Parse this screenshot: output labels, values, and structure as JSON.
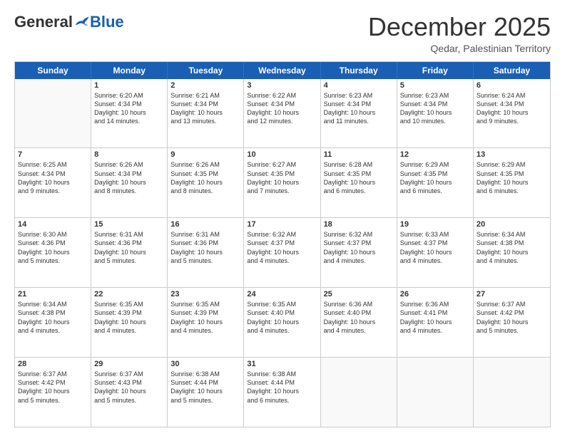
{
  "logo": {
    "general": "General",
    "blue": "Blue"
  },
  "title": "December 2025",
  "location": "Qedar, Palestinian Territory",
  "days_of_week": [
    "Sunday",
    "Monday",
    "Tuesday",
    "Wednesday",
    "Thursday",
    "Friday",
    "Saturday"
  ],
  "weeks": [
    [
      {
        "day": "",
        "info": ""
      },
      {
        "day": "1",
        "info": "Sunrise: 6:20 AM\nSunset: 4:34 PM\nDaylight: 10 hours\nand 14 minutes."
      },
      {
        "day": "2",
        "info": "Sunrise: 6:21 AM\nSunset: 4:34 PM\nDaylight: 10 hours\nand 13 minutes."
      },
      {
        "day": "3",
        "info": "Sunrise: 6:22 AM\nSunset: 4:34 PM\nDaylight: 10 hours\nand 12 minutes."
      },
      {
        "day": "4",
        "info": "Sunrise: 6:23 AM\nSunset: 4:34 PM\nDaylight: 10 hours\nand 11 minutes."
      },
      {
        "day": "5",
        "info": "Sunrise: 6:23 AM\nSunset: 4:34 PM\nDaylight: 10 hours\nand 10 minutes."
      },
      {
        "day": "6",
        "info": "Sunrise: 6:24 AM\nSunset: 4:34 PM\nDaylight: 10 hours\nand 9 minutes."
      }
    ],
    [
      {
        "day": "7",
        "info": "Sunrise: 6:25 AM\nSunset: 4:34 PM\nDaylight: 10 hours\nand 9 minutes."
      },
      {
        "day": "8",
        "info": "Sunrise: 6:26 AM\nSunset: 4:34 PM\nDaylight: 10 hours\nand 8 minutes."
      },
      {
        "day": "9",
        "info": "Sunrise: 6:26 AM\nSunset: 4:35 PM\nDaylight: 10 hours\nand 8 minutes."
      },
      {
        "day": "10",
        "info": "Sunrise: 6:27 AM\nSunset: 4:35 PM\nDaylight: 10 hours\nand 7 minutes."
      },
      {
        "day": "11",
        "info": "Sunrise: 6:28 AM\nSunset: 4:35 PM\nDaylight: 10 hours\nand 6 minutes."
      },
      {
        "day": "12",
        "info": "Sunrise: 6:29 AM\nSunset: 4:35 PM\nDaylight: 10 hours\nand 6 minutes."
      },
      {
        "day": "13",
        "info": "Sunrise: 6:29 AM\nSunset: 4:35 PM\nDaylight: 10 hours\nand 6 minutes."
      }
    ],
    [
      {
        "day": "14",
        "info": "Sunrise: 6:30 AM\nSunset: 4:36 PM\nDaylight: 10 hours\nand 5 minutes."
      },
      {
        "day": "15",
        "info": "Sunrise: 6:31 AM\nSunset: 4:36 PM\nDaylight: 10 hours\nand 5 minutes."
      },
      {
        "day": "16",
        "info": "Sunrise: 6:31 AM\nSunset: 4:36 PM\nDaylight: 10 hours\nand 5 minutes."
      },
      {
        "day": "17",
        "info": "Sunrise: 6:32 AM\nSunset: 4:37 PM\nDaylight: 10 hours\nand 4 minutes."
      },
      {
        "day": "18",
        "info": "Sunrise: 6:32 AM\nSunset: 4:37 PM\nDaylight: 10 hours\nand 4 minutes."
      },
      {
        "day": "19",
        "info": "Sunrise: 6:33 AM\nSunset: 4:37 PM\nDaylight: 10 hours\nand 4 minutes."
      },
      {
        "day": "20",
        "info": "Sunrise: 6:34 AM\nSunset: 4:38 PM\nDaylight: 10 hours\nand 4 minutes."
      }
    ],
    [
      {
        "day": "21",
        "info": "Sunrise: 6:34 AM\nSunset: 4:38 PM\nDaylight: 10 hours\nand 4 minutes."
      },
      {
        "day": "22",
        "info": "Sunrise: 6:35 AM\nSunset: 4:39 PM\nDaylight: 10 hours\nand 4 minutes."
      },
      {
        "day": "23",
        "info": "Sunrise: 6:35 AM\nSunset: 4:39 PM\nDaylight: 10 hours\nand 4 minutes."
      },
      {
        "day": "24",
        "info": "Sunrise: 6:35 AM\nSunset: 4:40 PM\nDaylight: 10 hours\nand 4 minutes."
      },
      {
        "day": "25",
        "info": "Sunrise: 6:36 AM\nSunset: 4:40 PM\nDaylight: 10 hours\nand 4 minutes."
      },
      {
        "day": "26",
        "info": "Sunrise: 6:36 AM\nSunset: 4:41 PM\nDaylight: 10 hours\nand 4 minutes."
      },
      {
        "day": "27",
        "info": "Sunrise: 6:37 AM\nSunset: 4:42 PM\nDaylight: 10 hours\nand 5 minutes."
      }
    ],
    [
      {
        "day": "28",
        "info": "Sunrise: 6:37 AM\nSunset: 4:42 PM\nDaylight: 10 hours\nand 5 minutes."
      },
      {
        "day": "29",
        "info": "Sunrise: 6:37 AM\nSunset: 4:43 PM\nDaylight: 10 hours\nand 5 minutes."
      },
      {
        "day": "30",
        "info": "Sunrise: 6:38 AM\nSunset: 4:44 PM\nDaylight: 10 hours\nand 5 minutes."
      },
      {
        "day": "31",
        "info": "Sunrise: 6:38 AM\nSunset: 4:44 PM\nDaylight: 10 hours\nand 6 minutes."
      },
      {
        "day": "",
        "info": ""
      },
      {
        "day": "",
        "info": ""
      },
      {
        "day": "",
        "info": ""
      }
    ]
  ]
}
